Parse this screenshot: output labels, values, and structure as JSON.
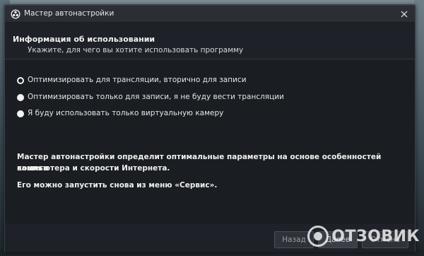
{
  "window": {
    "title": "Мастер автонастройки",
    "icon": "obs-logo-icon",
    "close_icon": "close-icon"
  },
  "header": {
    "heading": "Информация об использовании",
    "subheading": "Укажите, для чего вы хотите использовать программу"
  },
  "options": [
    {
      "label": "Оптимизировать для трансляции, вторично для записи",
      "checked": true
    },
    {
      "label": "Оптимизировать только для записи, я не буду вести трансляции",
      "checked": false
    },
    {
      "label": "Я буду использовать только виртуальную камеру",
      "checked": false
    }
  ],
  "info": {
    "line1": "Мастер автонастройки определит оптимальные параметры на основе особенностей вашего",
    "line2": "компьютера и скорости Интернета.",
    "line3": "Его можно запустить снова из меню «Сервис»."
  },
  "footer": {
    "back_label": "Назад",
    "next_label": "Далее",
    "cancel_label": "Отмена"
  },
  "watermark": {
    "text": "ОТЗОВИК"
  },
  "colors": {
    "dialog_bg": "#1e2127",
    "content_bg": "#1a1d22",
    "titlebar_bg": "#2b2e35",
    "text": "#e6e6e6"
  }
}
